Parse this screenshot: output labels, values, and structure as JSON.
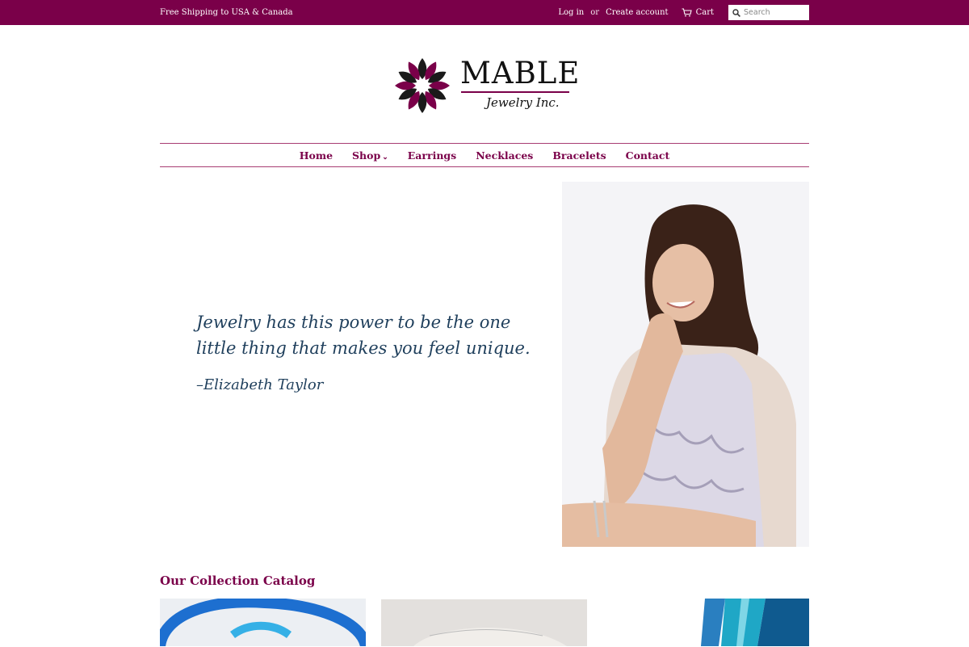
{
  "announcement": {
    "text": "Free Shipping to USA & Canada"
  },
  "header_links": {
    "login": "Log in",
    "or": "or",
    "create_account": "Create account",
    "cart": "Cart"
  },
  "search": {
    "placeholder": "Search"
  },
  "brand": {
    "name": "MABLE",
    "subtitle": "Jewelry Inc."
  },
  "nav": {
    "items": [
      "Home",
      "Shop",
      "Earrings",
      "Necklaces",
      "Bracelets",
      "Contact"
    ]
  },
  "hero": {
    "quote": "Jewelry has this power to be the one little thing that makes you feel unique.",
    "author": "–Elizabeth Taylor"
  },
  "collection": {
    "title": "Our Collection Catalog"
  },
  "colors": {
    "brand": "#7a0049",
    "quote": "#1f3f5c"
  },
  "icons": {
    "cart": "cart-icon",
    "search": "search-icon",
    "dropdown": "chevron-down-icon"
  }
}
